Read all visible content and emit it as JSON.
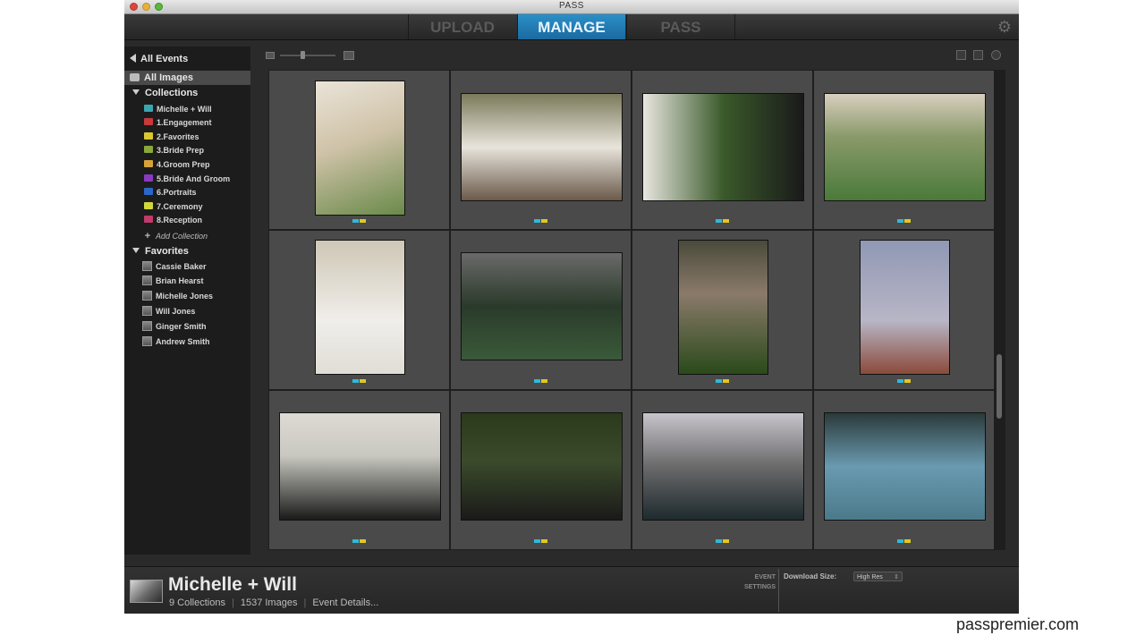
{
  "window": {
    "title": "PASS"
  },
  "nav": {
    "tabs": [
      {
        "label": "UPLOAD"
      },
      {
        "label": "MANAGE"
      },
      {
        "label": "PASS"
      }
    ]
  },
  "sidebar": {
    "all_events": "All Events",
    "all_images": "All Images",
    "collections_header": "Collections",
    "collections": [
      {
        "label": "Michelle + Will",
        "color": "#3aa6b0"
      },
      {
        "label": "1.Engagement",
        "color": "#c8393a"
      },
      {
        "label": "2.Favorites",
        "color": "#d8c830"
      },
      {
        "label": "3.Bride Prep",
        "color": "#8aa83a"
      },
      {
        "label": "4.Groom Prep",
        "color": "#d8a23a"
      },
      {
        "label": "5.Bride And Groom",
        "color": "#8a3ac0"
      },
      {
        "label": "6.Portraits",
        "color": "#2a68c8"
      },
      {
        "label": "7.Ceremony",
        "color": "#d0d83a"
      },
      {
        "label": "8.Reception",
        "color": "#c03a6a"
      }
    ],
    "add_collection": "Add Collection",
    "favorites_header": "Favorites",
    "favorites": [
      {
        "label": "Cassie Baker"
      },
      {
        "label": "Brian Hearst"
      },
      {
        "label": "Michelle Jones"
      },
      {
        "label": "Will Jones"
      },
      {
        "label": "Ginger Smith"
      },
      {
        "label": "Andrew Smith"
      }
    ]
  },
  "images": [
    {
      "bg": "linear-gradient(160deg,#eae4d8,#cfc2a8 45%,#6a8a4a)"
    },
    {
      "bg": "linear-gradient(180deg,#7a7a5a,#e8e4dc 50%,#6a5a4a)"
    },
    {
      "bg": "linear-gradient(90deg,#e8e6e0,#3a5a2a 50%,#1a1a1a)"
    },
    {
      "bg": "linear-gradient(180deg,#d8cfbf,#8a9a6a 40%,#4a7a3a)"
    },
    {
      "bg": "linear-gradient(180deg,#cfc7b6,#f0eeea 60%,#e0ddd6)"
    },
    {
      "bg": "linear-gradient(180deg,#6a6a6a,#2a3a2a 50%,#3a5a3a)"
    },
    {
      "bg": "linear-gradient(180deg,#4a4a3a,#8a7a6a 40%,#2a4a1a)"
    },
    {
      "bg": "linear-gradient(180deg,#9098b4,#b8b6c6 60%,#8a4a3a)"
    },
    {
      "bg": "linear-gradient(180deg,#dedad4,#c8c8c0 40%,#1a1a1a)"
    },
    {
      "bg": "linear-gradient(180deg,#2a3a1a,#3a4a2a 45%,#1a1a1a)"
    },
    {
      "bg": "linear-gradient(180deg,#c8c4cc,#6a6a6a 50%,#1e2a2e)"
    },
    {
      "bg": "linear-gradient(180deg,#2a3a3a,#6a9ab0 50%,#4a7a8a)"
    }
  ],
  "event": {
    "name": "Michelle + Will",
    "collections": "9 Collections",
    "images": "1537 Images",
    "details": "Event Details...",
    "settings_line1": "EVENT",
    "settings_line2": "SETTINGS",
    "download_label": "Download Size:",
    "download_value": "High Res"
  },
  "watermark": "passpremier.com"
}
